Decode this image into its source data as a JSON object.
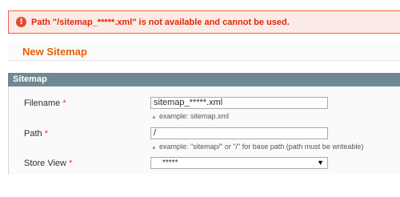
{
  "error": {
    "icon": "warning-icon",
    "message": "Path \"/sitemap_*****.xml\" is not available and cannot be used."
  },
  "page": {
    "title": "New Sitemap"
  },
  "fieldset": {
    "legend": "Sitemap",
    "filename": {
      "label": "Filename",
      "required_mark": "*",
      "value": "sitemap_*****.xml",
      "note": "example: sitemap.xml"
    },
    "path": {
      "label": "Path",
      "required_mark": "*",
      "value": "/",
      "note": "example: \"sitemap/\" or \"/\" for base path (path must be writeable)"
    },
    "store_view": {
      "label": "Store View",
      "required_mark": "*",
      "selected": "*****"
    }
  },
  "colors": {
    "error_text": "#df280a",
    "title_orange": "#eb5e00",
    "fieldset_header": "#6f8992"
  }
}
